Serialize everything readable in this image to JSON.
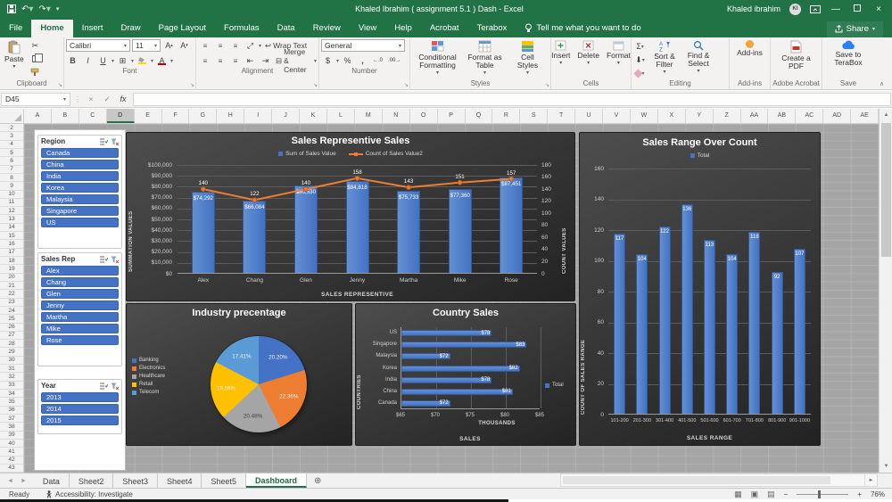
{
  "titlebar": {
    "title": "Khaled Ibrahim ( assignment 5.1 ) Dash  -  Excel",
    "user_name": "Khaled ibrahim",
    "user_initials": "KI"
  },
  "ribbon_tabs": [
    {
      "label": "File",
      "active": false
    },
    {
      "label": "Home",
      "active": true
    },
    {
      "label": "Insert",
      "active": false
    },
    {
      "label": "Draw",
      "active": false
    },
    {
      "label": "Page Layout",
      "active": false
    },
    {
      "label": "Formulas",
      "active": false
    },
    {
      "label": "Data",
      "active": false
    },
    {
      "label": "Review",
      "active": false
    },
    {
      "label": "View",
      "active": false
    },
    {
      "label": "Help",
      "active": false
    },
    {
      "label": "Acrobat",
      "active": false
    },
    {
      "label": "Terabox",
      "active": false
    }
  ],
  "tell_me": "Tell me what you want to do",
  "share_label": "Share",
  "ribbon": {
    "paste": "Paste",
    "font_name": "Calibri",
    "font_size": "11",
    "wrap_text": "Wrap Text",
    "merge_center": "Merge & Center",
    "number_format": "General",
    "conditional_formatting": "Conditional Formatting",
    "format_as_table": "Format as Table",
    "cell_styles": "Cell Styles",
    "insert": "Insert",
    "delete": "Delete",
    "format": "Format",
    "sort_filter": "Sort & Filter",
    "find_select": "Find & Select",
    "add_ins": "Add-ins",
    "create_pdf": "Create a PDF",
    "save_terabox": "Save to TeraBox",
    "groups": [
      "Clipboard",
      "Font",
      "Alignment",
      "Number",
      "Styles",
      "Cells",
      "Editing",
      "Add-ins",
      "Adobe Acrobat",
      "Save"
    ]
  },
  "formula_bar": {
    "name_box": "D45",
    "fx": "fx"
  },
  "grid": {
    "columns": [
      "A",
      "B",
      "C",
      "D",
      "E",
      "F",
      "G",
      "H",
      "I",
      "J",
      "K",
      "L",
      "M",
      "N",
      "O",
      "P",
      "Q",
      "R",
      "S",
      "T",
      "U",
      "V",
      "W",
      "X",
      "Y",
      "Z",
      "AA",
      "AB",
      "AC",
      "AD",
      "AE"
    ],
    "selected_column": "D",
    "row_start": 2,
    "row_end": 43
  },
  "slicers": [
    {
      "title": "Region",
      "items": [
        "Canada",
        "China",
        "India",
        "Korea",
        "Malaysia",
        "Singapore",
        "US"
      ]
    },
    {
      "title": "Sales Rep",
      "items": [
        "Alex",
        "Chang",
        "Glen",
        "Jenny",
        "Martha",
        "Mike",
        "Rose"
      ]
    },
    {
      "title": "Year",
      "items": [
        "2013",
        "2014",
        "2015"
      ]
    }
  ],
  "chart_data": [
    {
      "type": "combo-bar-line",
      "title": "Sales Representive Sales",
      "categories": [
        "Alex",
        "Chang",
        "Glen",
        "Jenny",
        "Martha",
        "Mike",
        "Rose"
      ],
      "series": [
        {
          "name": "Sum of Sales Value",
          "chart_type": "bar",
          "color": "#4472c4",
          "values": [
            74292,
            66084,
            80530,
            84818,
            75733,
            77360,
            87451
          ],
          "labels": [
            "$74,292",
            "$66,084",
            "$80,530",
            "$84,818",
            "$75,733",
            "$77,360",
            "$87,451"
          ]
        },
        {
          "name": "Count of Sales Value2",
          "chart_type": "line",
          "color": "#ed7d31",
          "values": [
            140,
            122,
            140,
            158,
            143,
            151,
            157
          ]
        }
      ],
      "y_left": {
        "title": "SUMMATION VALUES",
        "min": 0,
        "max": 100000,
        "step": 10000,
        "format": "usd"
      },
      "y_right": {
        "title": "COUNT VALUES",
        "min": 0,
        "max": 180,
        "step": 20
      },
      "x_title": "SALES REPRESENTIVE",
      "grid": true,
      "legend_position": "top"
    },
    {
      "type": "bar",
      "title": "Sales Range Over Count",
      "legend": "Total",
      "categories": [
        "101-200",
        "201-300",
        "301-400",
        "401-500",
        "501-600",
        "601-700",
        "701-800",
        "801-900",
        "901-1000"
      ],
      "values": [
        117,
        104,
        122,
        136,
        113,
        104,
        118,
        92,
        107
      ],
      "color": "#4472c4",
      "ylabel": "COUNT OF SALES RANGE",
      "xlabel": "SALES RANGE",
      "ylim": [
        0,
        160
      ],
      "ystep": 20,
      "grid": true,
      "legend_position": "top"
    },
    {
      "type": "pie",
      "title": "Industry precentage",
      "labels": [
        "Banking",
        "Electronics",
        "Healthcare",
        "Retail",
        "Telecom"
      ],
      "values": [
        20.2,
        22.36,
        20.48,
        19.56,
        17.41
      ],
      "value_labels": [
        "20.20%",
        "22.36%",
        "20.48%",
        "19.56%",
        "17.41%"
      ],
      "colors": [
        "#4472c4",
        "#ed7d31",
        "#a5a5a5",
        "#ffc000",
        "#5b9bd5"
      ],
      "legend_position": "left"
    },
    {
      "type": "hbar",
      "title": "Country Sales",
      "legend": "Total",
      "categories": [
        "US",
        "Singapore",
        "Malaysia",
        "Korea",
        "India",
        "China",
        "Canada"
      ],
      "values": [
        78,
        83,
        72,
        82,
        78,
        81,
        72
      ],
      "value_labels": [
        "$78",
        "$83",
        "$72",
        "$82",
        "$78",
        "$81",
        "$72"
      ],
      "color": "#4472c4",
      "xlim": [
        65,
        85
      ],
      "xstep": 5,
      "x_tick_prefix": "$",
      "x_units": "THOUSANDS",
      "xlabel": "SALES",
      "ylabel": "COUNTRIES",
      "grid": true,
      "legend_position": "right"
    }
  ],
  "sheet_tabs": [
    {
      "label": "Data",
      "active": false
    },
    {
      "label": "Sheet2",
      "active": false
    },
    {
      "label": "Sheet3",
      "active": false
    },
    {
      "label": "Sheet4",
      "active": false
    },
    {
      "label": "Sheet5",
      "active": false
    },
    {
      "label": "Dashboard",
      "active": true
    }
  ],
  "status_bar": {
    "ready": "Ready",
    "accessibility": "Accessibility: Investigate",
    "zoom": "76%"
  },
  "colors": {
    "excel_green": "#217346",
    "slicer_blue": "#4472c4",
    "bar_blue": "#4472c4",
    "line_orange": "#ed7d31",
    "chart_bg": "#3a3a3a"
  }
}
